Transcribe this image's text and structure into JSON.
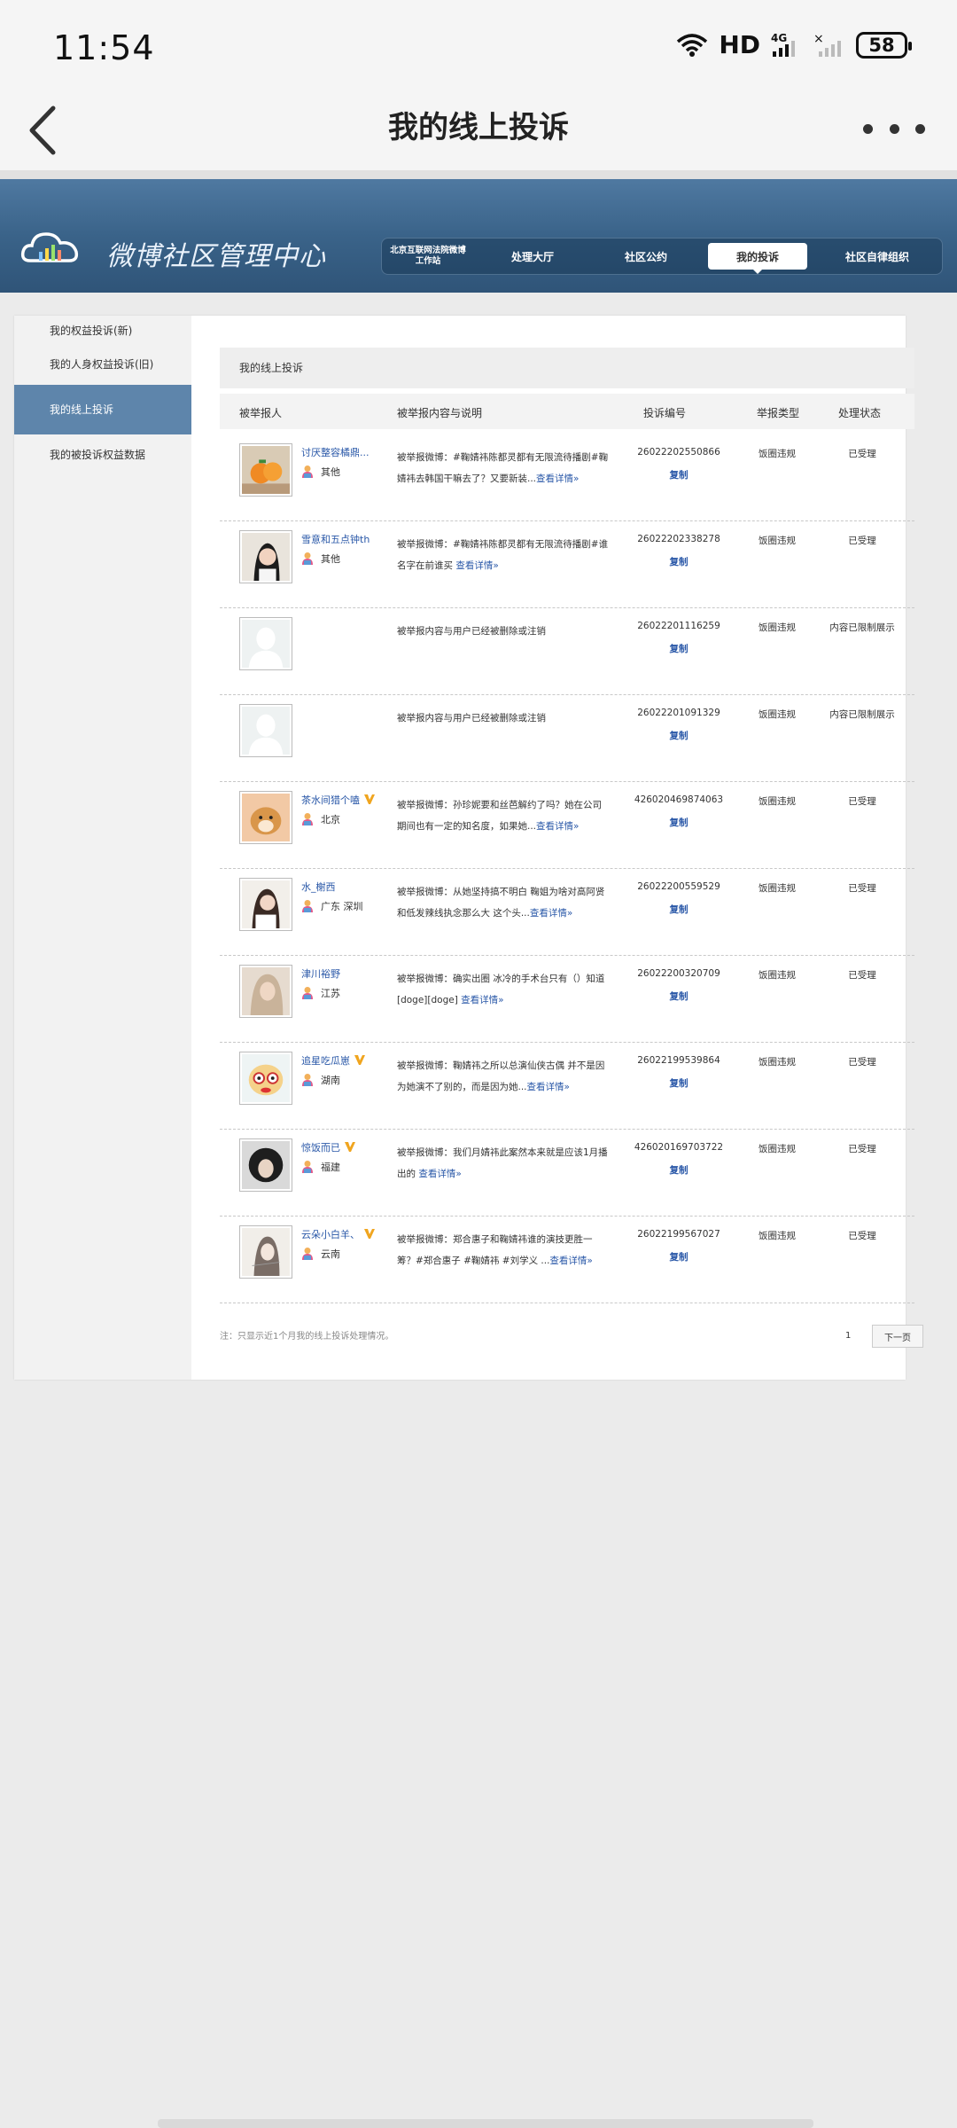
{
  "status_bar": {
    "time": "11:54",
    "signal": "HD",
    "network": "4G",
    "battery": "58"
  },
  "app_nav": {
    "title": "我的线上投诉"
  },
  "header": {
    "brand": "微博社区管理中心",
    "tabs": [
      {
        "line1": "北京互联网法院微博",
        "line2": "工作站"
      },
      {
        "label": "处理大厅"
      },
      {
        "label": "社区公约"
      },
      {
        "label": "我的投诉",
        "active": true
      },
      {
        "label": "社区自律组织"
      }
    ]
  },
  "sidebar": {
    "items": [
      {
        "label": "我的权益投诉(新)"
      },
      {
        "label": "我的人身权益投诉(旧)"
      },
      {
        "label": "我的线上投诉",
        "active": true
      },
      {
        "label": "我的被投诉权益数据"
      }
    ]
  },
  "main": {
    "section_title": "我的线上投诉",
    "columns": [
      "被举报人",
      "被举报内容与说明",
      "投诉编号",
      "举报类型",
      "处理状态"
    ],
    "copy_label": "复制",
    "detail_label": "查看详情»",
    "rows": [
      {
        "name": "讨厌整容橘鼎...",
        "verified": false,
        "location": "其他",
        "desc": "被举报微博：#鞠婧祎陈都灵都有无限流待播剧#鞠婧祎去韩国干嘛去了？又要新装...",
        "id": "26022202550866",
        "type": "饭圈违规",
        "status": "已受理",
        "avatar": "orange"
      },
      {
        "name": "雪意和五点钟th",
        "verified": false,
        "location": "其他",
        "desc": "被举报微博：#鞠婧祎陈都灵都有无限流待播剧#谁名字在前谁买 ",
        "id": "26022202338278",
        "type": "饭圈违规",
        "status": "已受理",
        "avatar": "girl"
      },
      {
        "name": "",
        "verified": false,
        "location": "",
        "desc": "被举报内容与用户已经被删除或注销",
        "id": "26022201116259",
        "type": "饭圈违规",
        "status": "内容已限制展示",
        "avatar": "blank"
      },
      {
        "name": "",
        "verified": false,
        "location": "",
        "desc": "被举报内容与用户已经被删除或注销",
        "id": "26022201091329",
        "type": "饭圈违规",
        "status": "内容已限制展示",
        "avatar": "blank"
      },
      {
        "name": "茶水间猎个嗑",
        "verified": true,
        "location": "北京",
        "desc": "被举报微博：孙珍妮要和丝芭解约了吗？她在公司期间也有一定的知名度，如果她...",
        "id": "4260204698740​63",
        "type": "饭圈违规",
        "status": "已受理",
        "avatar": "dog"
      },
      {
        "name": "水_榭西",
        "verified": false,
        "location": "广东 深圳",
        "desc": "被举报微博：从她坚持搞不明白 鞠姐为啥对高阿贤和低发辣线执念那么大 这个头...",
        "id": "26022200559529",
        "type": "饭圈违规",
        "status": "已受理",
        "avatar": "woman"
      },
      {
        "name": "津川裕野",
        "verified": false,
        "location": "江苏",
        "desc": "被举报微博：确实出圈 冰冷的手术台只有（）知道[doge][doge] ",
        "id": "26022200320709",
        "type": "饭圈违规",
        "status": "已受理",
        "avatar": "blonde"
      },
      {
        "name": "追星吃瓜崽",
        "verified": true,
        "location": "湖南",
        "desc": "被举报微博：鞠婧祎之所以总演仙侠古偶 并不是因为她演不了别的，而是因为她...",
        "id": "26022199539864",
        "type": "饭圈违规",
        "status": "已受理",
        "avatar": "cartoon"
      },
      {
        "name": "惊饭而已",
        "verified": true,
        "location": "福建",
        "desc": "被举报微博：我们月婧祎此案然本来就是应该1月播出的 ",
        "id": "426020169703722",
        "type": "饭圈违规",
        "status": "已受理",
        "avatar": "dark"
      },
      {
        "name": "云朵小白羊、",
        "verified": true,
        "location": "云南",
        "desc": "被举报微博：郑合惠子和鞠婧祎谁的演技更胜一筹？#郑合惠子 #鞠婧祎 #刘学义 ...",
        "id": "26022199567027",
        "type": "饭圈违规",
        "status": "已受理",
        "avatar": "sketch"
      }
    ],
    "note": "注：只显示近1个月我的线上投诉处理情况。",
    "page": "1",
    "next_label": "下一页"
  }
}
